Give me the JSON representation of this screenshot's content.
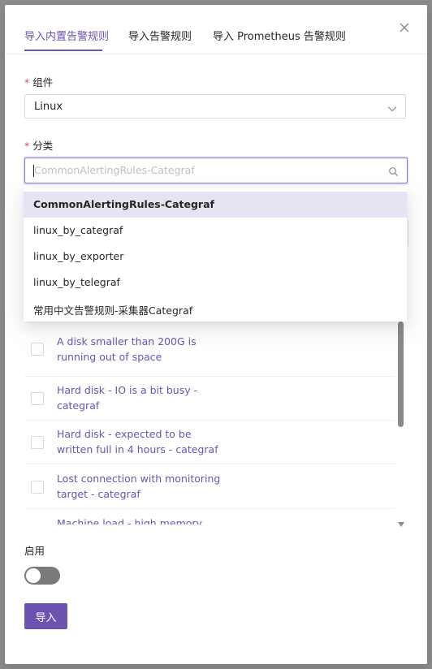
{
  "tabs": [
    {
      "label": "导入内置告警规则",
      "active": true
    },
    {
      "label": "导入告警规则",
      "active": false
    },
    {
      "label": "导入 Prometheus 告警规则",
      "active": false
    }
  ],
  "form": {
    "required_mark": "*",
    "component": {
      "label": "组件",
      "value": "Linux"
    },
    "category": {
      "label": "分类",
      "placeholder": "CommonAlertingRules-Categraf",
      "options": [
        "CommonAlertingRules-Categraf",
        "linux_by_categraf",
        "linux_by_exporter",
        "linux_by_telegraf",
        "常用中文告警规则-采集器Categraf"
      ],
      "selected_index": 0
    },
    "rules": [
      {
        "name": "A disk smaller than 200G is running out of space"
      },
      {
        "name": "Hard disk - IO is a bit busy - categraf"
      },
      {
        "name": "Hard disk - expected to be written full in 4 hours - categraf"
      },
      {
        "name": "Lost connection with monitoring target - categraf"
      },
      {
        "name": "Machine load - high memory,"
      }
    ],
    "enable": {
      "label": "启用",
      "on": false
    },
    "import_button": "导入"
  },
  "colors": {
    "accent": "#6c53b1",
    "option_highlight": "#e8e3f2",
    "required": "#e5484d"
  },
  "icons": [
    "close-icon",
    "chevron-down-icon",
    "search-icon",
    "caret-down-icon"
  ]
}
